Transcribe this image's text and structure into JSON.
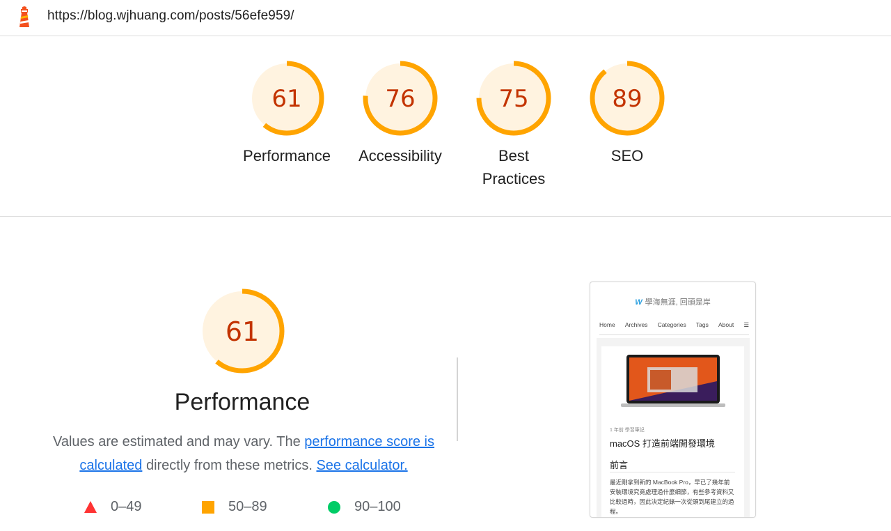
{
  "header": {
    "url": "https://blog.wjhuang.com/posts/56efe959/",
    "logo_icon": "lighthouse-icon"
  },
  "colors": {
    "average": "#ffa400",
    "average_bg": "#fff3e0",
    "average_text": "#c33300",
    "fail": "#ff3333",
    "pass": "#00cc66",
    "link": "#1a73e8"
  },
  "scores": [
    {
      "label": "Performance",
      "score": "61",
      "value": 61
    },
    {
      "label": "Accessibility",
      "score": "76",
      "value": 76
    },
    {
      "label": "Best Practices",
      "score": "75",
      "value": 75
    },
    {
      "label": "SEO",
      "score": "89",
      "value": 89
    }
  ],
  "performance": {
    "score": "61",
    "value": 61,
    "title": "Performance",
    "desc_prefix": "Values are estimated and may vary. The ",
    "link_score": "performance score is calculated",
    "desc_middle": " directly from these metrics. ",
    "link_calculator": "See calculator.",
    "legend": [
      {
        "range": "0–49",
        "shape": "triangle-icon"
      },
      {
        "range": "50–89",
        "shape": "square-icon"
      },
      {
        "range": "90–100",
        "shape": "circle-icon"
      }
    ]
  },
  "screenshot": {
    "brand": "學海無涯, 回頭是岸",
    "nav": [
      "Home",
      "Archives",
      "Categories",
      "Tags",
      "About"
    ],
    "meta": "1 年前   學習筆記",
    "title": "macOS 打造前端開發環境",
    "heading": "前言",
    "body": "最近剛拿到新的 MacBook Pro，早已了幾年前安裝環境究竟處理過什麼細節，有些參考資料又比較過時，因此決定紀錄一次從頭到尾建立的過程。"
  }
}
